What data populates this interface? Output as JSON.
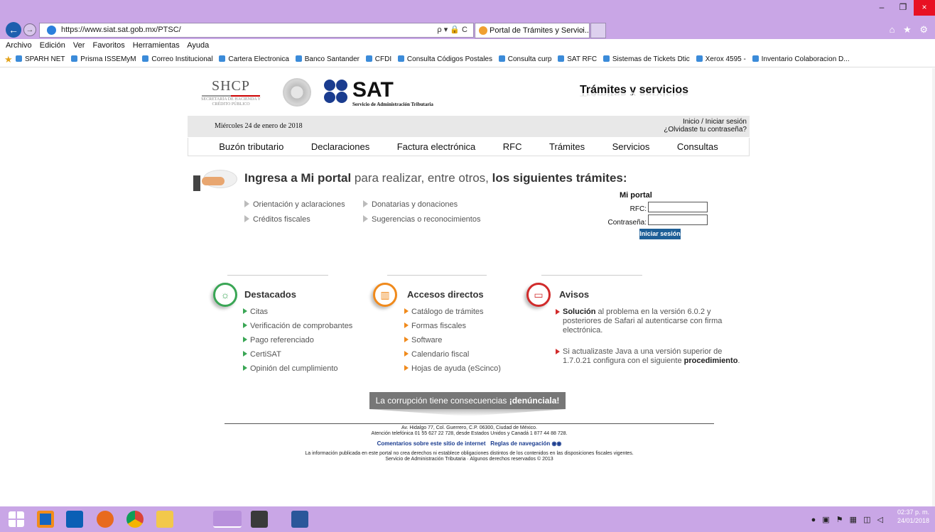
{
  "browser": {
    "url": "https://www.siat.sat.gob.mx/PTSC/",
    "url_controls": "ρ ▾ 🔒 C",
    "tab_title": "Portal de Trámites y Servici...",
    "tab_close": "×",
    "right_icons": "⌂ ★ ⚙",
    "window_controls": [
      "–",
      "❐",
      "×"
    ],
    "back_glyph": "←",
    "forward_glyph": "→",
    "menu": [
      "Archivo",
      "Edición",
      "Ver",
      "Favoritos",
      "Herramientas",
      "Ayuda"
    ],
    "favorites": [
      "SPARH NET",
      "Prisma ISSEMyM",
      "Correo Institucional",
      "Cartera Electronica",
      "Banco Santander",
      "CFDI",
      "Consulta Códigos Postales",
      "Consulta curp",
      "SAT RFC",
      "Sistemas de Tickets Dtic",
      "Xerox 4595 -",
      "Inventario Colaboracion D..."
    ]
  },
  "header": {
    "shcp_big": "SHCP",
    "shcp_small": "SECRETARÍA DE HACIENDA Y CRÉDITO PÚBLICO",
    "sat_word": "SAT",
    "sat_sub": "Servicio de Administración Tributaria",
    "section_title": "Trámites y servicios"
  },
  "infobar": {
    "date": "Miércoles 24 de enero de 2018",
    "login": "Inicio / Iniciar sesión",
    "forgot": "¿Olvidaste tu contraseña?"
  },
  "nav": [
    "Buzón tributario",
    "Declaraciones",
    "Factura electrónica",
    "RFC",
    "Trámites",
    "Servicios",
    "Consultas"
  ],
  "promo": {
    "headline_a": "Ingresa a Mi portal",
    "headline_b": " para realizar, entre otros, ",
    "headline_c": "los siguientes trámites:",
    "items": [
      "Orientación y aclaraciones",
      "Créditos fiscales",
      "Donatarias y donaciones",
      "Sugerencias o reconocimientos"
    ]
  },
  "login_form": {
    "title": "Mi portal",
    "rfc_label": "RFC:",
    "password_label": "Contraseña:",
    "rfc_value": "",
    "password_value": "",
    "button": "Iniciar sesión"
  },
  "sections": {
    "destacados": {
      "title": "Destacados",
      "color": "#3aa655",
      "items": [
        "Citas",
        "Verificación de comprobantes",
        "Pago referenciado",
        "CertiSAT",
        "Opinión del cumplimiento"
      ]
    },
    "accesos": {
      "title": "Accesos directos",
      "color": "#f08a1c",
      "items": [
        "Catálogo de trámites",
        "Formas fiscales",
        "Software",
        "Calendario fiscal",
        "Hojas de ayuda (eScinco)"
      ]
    },
    "avisos": {
      "title": "Avisos",
      "color": "#d12b2b",
      "a_bold": "Solución",
      "a_text": " al problema en la versión 6.0.2 y posteriores de Safari al autenticarse con firma electrónica.",
      "b_text": "Si actualizaste Java a una versión superior de 1.7.0.21 configura con el siguiente ",
      "b_bold": "procedimiento",
      "b_end": "."
    }
  },
  "corruption": {
    "text": "La corrupción tiene consecuencias ",
    "bold": "¡denúnciala!"
  },
  "footer": {
    "address": "Av. Hidalgo 77, Col. Guerrero, C.P. 06300, Ciudad de México.",
    "phone": "Atención telefónica 01 55 627 22 728, desde Estados Unidos y Canadá 1 877 44 88 728.",
    "link1": "Comentarios sobre este sitio de internet",
    "link2": "Reglas de navegación",
    "legal1": "La información publicada en este portal no crea derechos ni establece obligaciones distintos de los contenidos en las disposiciones fiscales vigentes.",
    "legal2": "Servicio de Administración Tributaria · Algunos derechos reservados © 2013"
  },
  "taskbar": {
    "time": "02:37 p. m.",
    "date": "24/01/2018",
    "apps": [
      "windows-start",
      "task-view",
      "outlook",
      "firefox",
      "chrome",
      "file-explorer",
      "internet-explorer",
      "app-icon",
      "word"
    ]
  }
}
